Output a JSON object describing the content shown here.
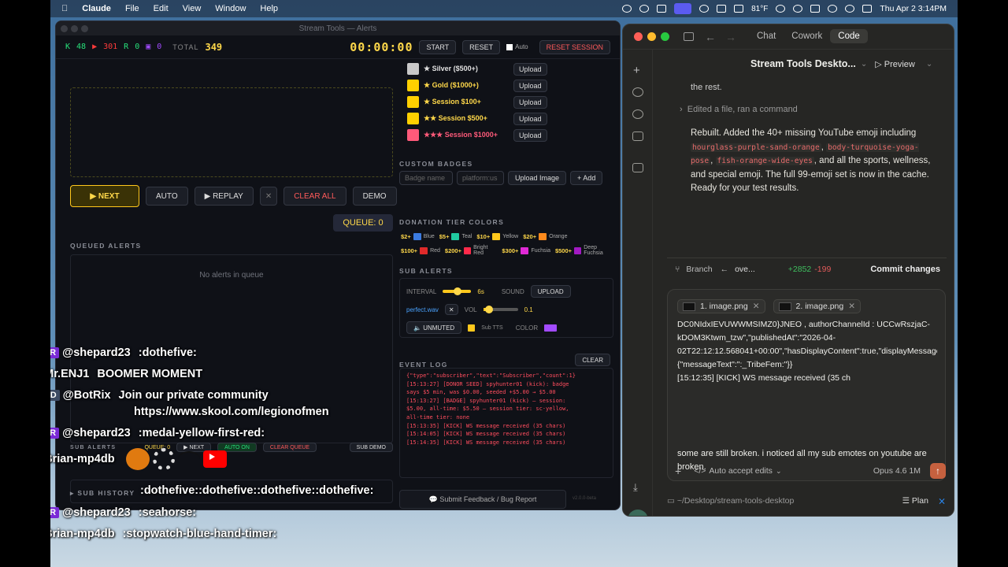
{
  "menubar": {
    "app": "Claude",
    "items": [
      "File",
      "Edit",
      "View",
      "Window",
      "Help"
    ],
    "weather": "81°F",
    "datetime": "Thu Apr 2  3:14PM"
  },
  "stream": {
    "title": "Stream Tools — Alerts",
    "stats": {
      "k": "K",
      "k_val": "48",
      "y": "▶",
      "y_val": "301",
      "r": "R",
      "r_val": "0",
      "t": "▣",
      "t_val": "0"
    },
    "total_label": "TOTAL",
    "total": "349",
    "timer": "00:00:00",
    "start": "START",
    "reset": "RESET",
    "auto": "Auto",
    "reset_session": "RESET SESSION",
    "next": "▶ NEXT",
    "auto_btn": "AUTO",
    "replay": "▶ REPLAY",
    "x": "✕",
    "clear_all": "CLEAR ALL",
    "demo": "DEMO",
    "queue": "QUEUE: 0",
    "queued_label": "QUEUED ALERTS",
    "no_alerts": "No alerts in queue",
    "sub_alerts_small": "SUB ALERTS",
    "queue_small": "QUEUE: 0",
    "next_small": "▶ NEXT",
    "auto_on": "AUTO ON",
    "clear_queue": "CLEAR QUEUE",
    "sub_demo": "SUB DEMO",
    "sub_history": "▸ SUB HISTORY",
    "badges": [
      {
        "name": "★ Silver ($500+)",
        "color": "#c9c9c9",
        "tc": "#e0e0e0"
      },
      {
        "name": "★ Gold ($1000+)",
        "color": "#ffd000",
        "tc": "#ffd84a"
      },
      {
        "name": "★ Session $100+",
        "color": "#ffd000",
        "tc": "#ffd84a"
      },
      {
        "name": "★★ Session $500+",
        "color": "#ffd000",
        "tc": "#ffd84a"
      },
      {
        "name": "★★★ Session $1000+",
        "color": "#ff5a7a",
        "tc": "#ff5a7a"
      }
    ],
    "upload": "Upload",
    "custom_badges": "CUSTOM BADGES",
    "badge_name_ph": "Badge name",
    "platform_ph": "platform:us",
    "upload_image": "Upload Image",
    "add": "+ Add",
    "donation_tier": "DONATION TIER COLORS",
    "tiers1": [
      {
        "amt": "$2+",
        "name": "Blue",
        "c": "#3b7be0"
      },
      {
        "amt": "$5+",
        "name": "Teal",
        "c": "#20c9a0"
      },
      {
        "amt": "$10+",
        "name": "Yellow",
        "c": "#ffc81c"
      },
      {
        "amt": "$20+",
        "name": "Orange",
        "c": "#ff8a1c"
      }
    ],
    "tiers2": [
      {
        "amt": "$100+",
        "name": "Red",
        "c": "#e02a2a"
      },
      {
        "amt": "$200+",
        "name": "Bright Red",
        "c": "#ff2a4a"
      },
      {
        "amt": "$300+",
        "name": "Fuchsia",
        "c": "#e02ad6"
      },
      {
        "amt": "$500+",
        "name": "Deep Fuchsia",
        "c": "#a21ac2"
      }
    ],
    "sub_alerts": "SUB ALERTS",
    "interval": "INTERVAL",
    "interval_val": "6s",
    "sound": "SOUND",
    "upload_btn": "UPLOAD",
    "file": "perfect.wav",
    "vol": "VOL",
    "vol_val": "0.1",
    "unmuted": "UNMUTED",
    "subtts": "Sub TTS",
    "color": "COLOR",
    "event_log": "EVENT LOG",
    "clear": "CLEAR",
    "log": [
      "{\"type\":\"subscriber\",\"text\":\"Subscriber\",\"count\":1}",
      "[15:13:27] [DONOR SEED] spyhunter01 (kick): badge",
      "says $5 min, was $0.00, seeded +$5.00 → $5.00",
      "[15:13:27] [BADGE] spyhunter01 (kick) — session:",
      "$5.00, all-time: $5.50 — session tier: sc-yellow,",
      "all-time tier: none",
      "[15:13:35] [KICK] WS message received (35 chars)",
      "[15:14:05] [KICK] WS message received (35 chars)",
      "[15:14:35] [KICK] WS message received (35 chars)"
    ],
    "feedback": "💬 Submit Feedback / Bug Report",
    "version": "v2.0.0-beta"
  },
  "chat": [
    {
      "badge": "MBR",
      "user": "@shepard23",
      "text": ":dothefive:"
    },
    {
      "badge": "",
      "user": "@Mr.ENJ1",
      "text": "BOOMER MOMENT"
    },
    {
      "badge": "MOD",
      "user": "@BotRix",
      "text": "Join our private community"
    },
    {
      "badge": "",
      "user": "",
      "text": "https://www.skool.com/legionofmen"
    },
    {
      "badge": "MBR",
      "user": "@shepard23",
      "text": ":medal-yellow-first-red:"
    },
    {
      "badge": "",
      "user": "@Brian-mp4db",
      "text": ""
    },
    {
      "badge": "",
      "user": "",
      "text": ":dothefive::dothefive::dothefive::dothefive:"
    },
    {
      "badge": "MBR",
      "user": "@shepard23",
      "text": ":seahorse:"
    },
    {
      "badge": "",
      "user": "@Brian-mp4db",
      "text": ":stopwatch-blue-hand-timer:"
    }
  ],
  "claude": {
    "tabs": [
      "Chat",
      "Cowork",
      "Code"
    ],
    "project": "Stream Tools Deskto...",
    "preview": "Preview",
    "prev_line": "the rest.",
    "edited": "Edited a file, ran a command",
    "msg1": "Rebuilt. Added the 40+ missing YouTube emoji including ",
    "code1": "hourglass-purple-sand-orange",
    "msg2": ", ",
    "code2": "body-turquoise-yoga-pose",
    "msg3": ", ",
    "code3": "fish-orange-wide-eyes",
    "msg4": ", and all the sports, wellness, and special emoji. The full 99-emoji set is now in the cache.",
    "msg5": "Ready for your test results.",
    "branch": "Branch",
    "branch_name": "ove...",
    "diff_add": "+2852",
    "diff_del": "-199",
    "commit": "Commit changes",
    "att1": "1. image.png",
    "att2": "2. image.png",
    "pasted": "DC0NIdxIEVUWWMSIMZ0}JNEO , authorChannelId : UCCwRszjaC-kDOM3Ktwm_tzw\",\"publishedAt\":\"2026-04-02T22:12:12.568041+00:00\",\"hasDisplayContent\":true,\"displayMessage\":\":_TribeFem:\",\"textMessageDetails\":{\"messageText\":\":_TribeFem:\"}}",
    "pasted2": "[15:12:35] [KICK] WS message received (35 ch",
    "query": "some are still broken. i noticed all my sub emotes on youtube are broken.",
    "auto_accept": "Auto accept edits",
    "model": "Opus 4.6 1M",
    "path": "~/Desktop/stream-tools-desktop",
    "plan": "Plan"
  }
}
